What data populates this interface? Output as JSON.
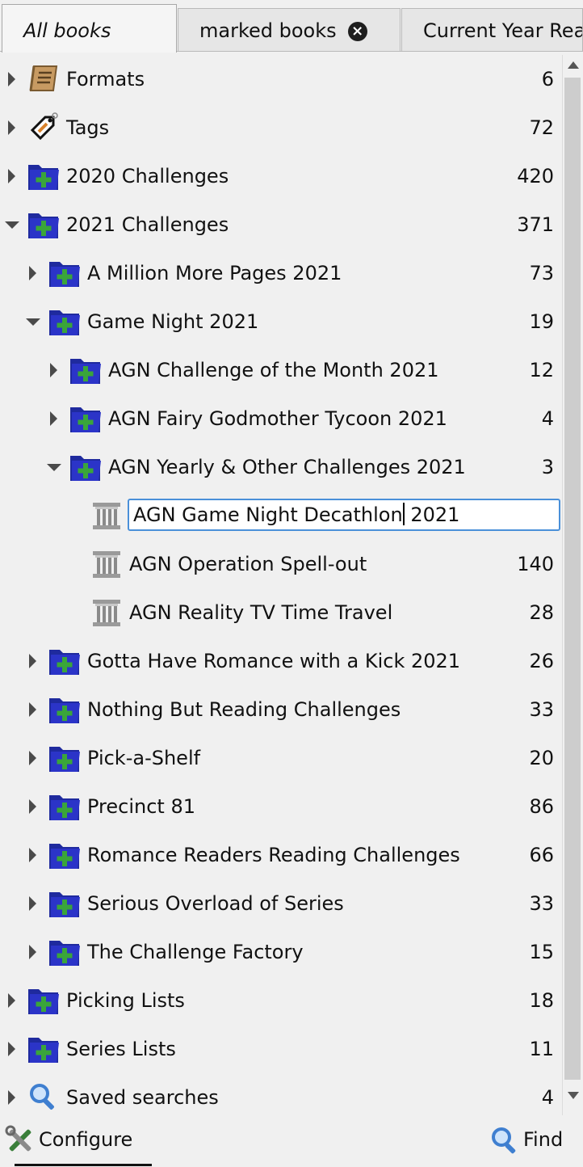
{
  "tabs": [
    {
      "label": "All books",
      "active": true
    },
    {
      "label": "marked books",
      "closable": true
    },
    {
      "label": "Current Year Rea"
    }
  ],
  "tree": {
    "rows": [
      {
        "label": "Formats",
        "count": "6",
        "icon": "book-icon",
        "arrow": "right",
        "level": 0
      },
      {
        "label": "Tags",
        "count": "72",
        "icon": "tag-icon",
        "arrow": "right",
        "level": 0
      },
      {
        "label": "2020 Challenges",
        "count": "420",
        "icon": "folder-plus-icon",
        "arrow": "right",
        "level": 0
      },
      {
        "label": "2021 Challenges",
        "count": "371",
        "icon": "folder-plus-icon",
        "arrow": "down",
        "level": 0
      },
      {
        "label": "A Million More Pages 2021",
        "count": "73",
        "icon": "folder-plus-icon",
        "arrow": "right",
        "level": 1
      },
      {
        "label": "Game Night 2021",
        "count": "19",
        "icon": "folder-plus-icon",
        "arrow": "down",
        "level": 1
      },
      {
        "label": "AGN Challenge of the Month 2021",
        "count": "12",
        "icon": "folder-plus-icon",
        "arrow": "right",
        "level": 2
      },
      {
        "label": "AGN Fairy Godmother Tycoon 2021",
        "count": "4",
        "icon": "folder-plus-icon",
        "arrow": "right",
        "level": 2
      },
      {
        "label": "AGN Yearly & Other Challenges 2021",
        "count": "3",
        "icon": "folder-plus-icon",
        "arrow": "down",
        "level": 2
      },
      {
        "label": "AGN Game Night Decathlon 2021",
        "count": "",
        "icon": "column-icon",
        "arrow": "none",
        "level": 3,
        "editing": true
      },
      {
        "label": "AGN Operation Spell-out",
        "count": "140",
        "icon": "column-icon",
        "arrow": "none",
        "level": 3
      },
      {
        "label": "AGN Reality TV Time Travel",
        "count": "28",
        "icon": "column-icon",
        "arrow": "none",
        "level": 3
      },
      {
        "label": "Gotta Have Romance with a Kick 2021",
        "count": "26",
        "icon": "folder-plus-icon",
        "arrow": "right",
        "level": 1
      },
      {
        "label": "Nothing But Reading Challenges",
        "count": "33",
        "icon": "folder-plus-icon",
        "arrow": "right",
        "level": 1
      },
      {
        "label": "Pick-a-Shelf",
        "count": "20",
        "icon": "folder-plus-icon",
        "arrow": "right",
        "level": 1
      },
      {
        "label": "Precinct 81",
        "count": "86",
        "icon": "folder-plus-icon",
        "arrow": "right",
        "level": 1
      },
      {
        "label": "Romance Readers Reading Challenges",
        "count": "66",
        "icon": "folder-plus-icon",
        "arrow": "right",
        "level": 1
      },
      {
        "label": "Serious Overload of Series",
        "count": "33",
        "icon": "folder-plus-icon",
        "arrow": "right",
        "level": 1
      },
      {
        "label": "The Challenge Factory",
        "count": "15",
        "icon": "folder-plus-icon",
        "arrow": "right",
        "level": 1
      },
      {
        "label": "Picking Lists",
        "count": "18",
        "icon": "folder-plus-icon",
        "arrow": "right",
        "level": 0
      },
      {
        "label": "Series Lists",
        "count": "11",
        "icon": "folder-plus-icon",
        "arrow": "right",
        "level": 0
      },
      {
        "label": "Saved searches",
        "count": "4",
        "icon": "search-icon",
        "arrow": "right",
        "level": 0
      }
    ],
    "edit_text_before_caret": "AGN Game Night Decathlon",
    "edit_text_after_caret": " 2021"
  },
  "bottom": {
    "configure_label": "Configure",
    "find_label": "Find"
  },
  "colors": {
    "folder": "#2b34c8",
    "plus": "#3aa53a",
    "selection_border": "#4a90d9"
  }
}
